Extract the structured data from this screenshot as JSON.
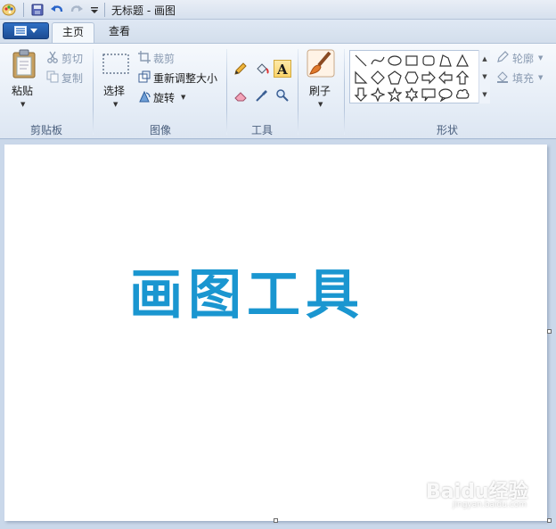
{
  "window": {
    "title": "无标题 - 画图"
  },
  "tabs": [
    {
      "label": "主页",
      "active": true
    },
    {
      "label": "查看",
      "active": false
    }
  ],
  "clipboard": {
    "paste": "粘贴",
    "cut": "剪切",
    "copy": "复制",
    "group": "剪贴板"
  },
  "image": {
    "select": "选择",
    "crop": "裁剪",
    "resize": "重新调整大小",
    "rotate": "旋转",
    "group": "图像"
  },
  "tools": {
    "group": "工具",
    "selected": "text-tool"
  },
  "brushes": {
    "label": "刷子"
  },
  "shapes": {
    "outline": "轮廓",
    "fill": "填充",
    "group": "形状"
  },
  "canvas": {
    "text": "画图工具",
    "text_color": "#1a96d0"
  },
  "watermark": {
    "brand": "Baidu经验",
    "url": "jingyan.baidu.com"
  },
  "colors": {
    "accent": "#1c4c93",
    "ribbon_bg": "#e4ecf6",
    "workspace_bg": "#cad8ea"
  }
}
